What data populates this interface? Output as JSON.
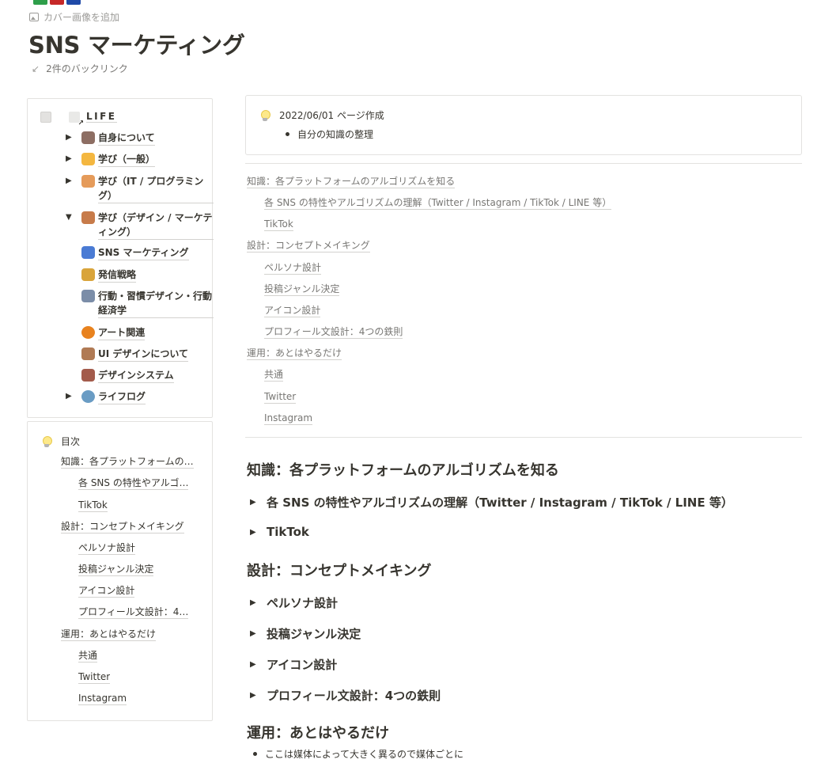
{
  "page": {
    "cover_link": "カバー画像を追加",
    "title": "SNS マーケティング",
    "backlinks": "2件のバックリンク",
    "icon_colors": [
      "#2e9e4a",
      "#c62828",
      "#1f4aa8"
    ]
  },
  "nav": {
    "root_label": "LIFE",
    "items": [
      {
        "label": "自身について",
        "toggle": "▶",
        "emoji": "owl-icon",
        "color": "#8d6e63"
      },
      {
        "label": "学び（一般）",
        "toggle": "▶",
        "emoji": "student-icon",
        "color": "#f4b740"
      },
      {
        "label": "学び（IT / プログラミング）",
        "toggle": "▶",
        "emoji": "technologist-icon",
        "color": "#e59b5a"
      },
      {
        "label": "学び（デザイン / マーケティング）",
        "toggle": "▼",
        "emoji": "palette-icon",
        "color": "#c77b4a"
      },
      {
        "label": "SNS マーケティング",
        "toggle": "",
        "emoji": "chart-icon",
        "color": "#4a7bd4"
      },
      {
        "label": "発信戦略",
        "toggle": "",
        "emoji": "megaphone-icon",
        "color": "#d9a43a"
      },
      {
        "label": "行動・習慣デザイン・行動経済学",
        "toggle": "",
        "emoji": "train-icon",
        "color": "#7b8da8"
      },
      {
        "label": "アート関連",
        "toggle": "",
        "emoji": "pumpkin-icon",
        "color": "#e8821e"
      },
      {
        "label": "UI デザインについて",
        "toggle": "",
        "emoji": "palette-icon",
        "color": "#b07a54"
      },
      {
        "label": "デザインシステム",
        "toggle": "",
        "emoji": "building-icon",
        "color": "#a35b4b"
      },
      {
        "label": "ライフログ",
        "toggle": "▶",
        "emoji": "globe-icon",
        "color": "#6a9cc4"
      }
    ]
  },
  "toc": {
    "title": "目次",
    "items": [
      "知識：各プラットフォームの…",
      "各 SNS の特性やアルゴ…",
      "TikTok",
      "設計：コンセプトメイキング",
      "ペルソナ設計",
      "投稿ジャンル決定",
      "アイコン設計",
      "プロフィール文設計：4…",
      "運用：あとはやるだけ",
      "共通",
      "Twitter",
      "Instagram"
    ]
  },
  "callout": {
    "title": "2022/06/01 ページ作成",
    "bullet": "自分の知識の整理"
  },
  "main_toc": [
    "知識：各プラットフォームのアルゴリズムを知る",
    "各 SNS の特性やアルゴリズムの理解（Twitter / Instagram / TikTok / LINE 等）",
    "TikTok",
    "設計：コンセプトメイキング",
    "ペルソナ設計",
    "投稿ジャンル決定",
    "アイコン設計",
    "プロフィール文設計：4つの鉄則",
    "運用：あとはやるだけ",
    "共通",
    "Twitter",
    "Instagram"
  ],
  "sections": {
    "h_knowledge": "知識：各プラットフォームのアルゴリズムを知る",
    "t_sns": "各 SNS の特性やアルゴリズムの理解（Twitter / Instagram / TikTok / LINE 等）",
    "t_tiktok": "TikTok",
    "h_design": "設計：コンセプトメイキング",
    "t_persona": "ペルソナ設計",
    "t_genre": "投稿ジャンル決定",
    "t_icon": "アイコン設計",
    "t_profile": "プロフィール文設計：4つの鉄則",
    "h_ops": "運用：あとはやるだけ",
    "bullet": "ここは媒体によって大きく異るので媒体ごとに"
  }
}
